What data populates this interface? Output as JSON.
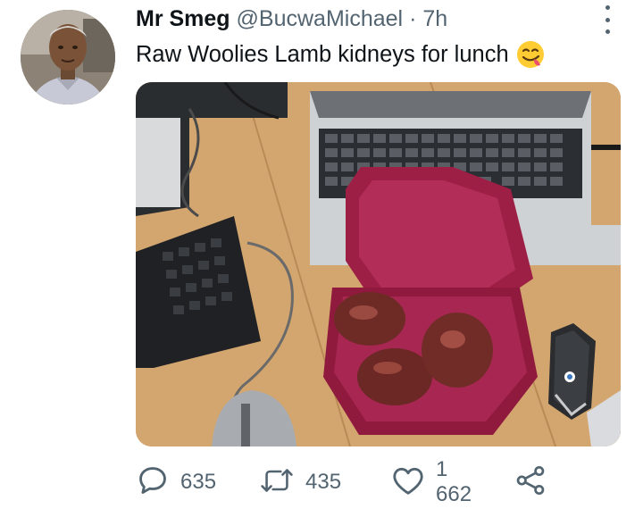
{
  "tweet": {
    "author": {
      "display_name": "Mr Smeg",
      "handle": "@BucwaMichael",
      "separator": "·",
      "time": "7h"
    },
    "text": "Raw Woolies Lamb kidneys for lunch",
    "emoji": "face-savoring-food-emoji",
    "media_icon": "photo"
  },
  "actions": {
    "reply": {
      "icon": "reply-bubble-icon",
      "count": "635"
    },
    "retweet": {
      "icon": "retweet-icon",
      "count": "435"
    },
    "like": {
      "icon": "heart-icon",
      "count": "1 662"
    },
    "share": {
      "icon": "share-icon"
    }
  },
  "colors": {
    "text": "#0f1419",
    "secondary": "#536471",
    "container": "#9e1f45"
  }
}
